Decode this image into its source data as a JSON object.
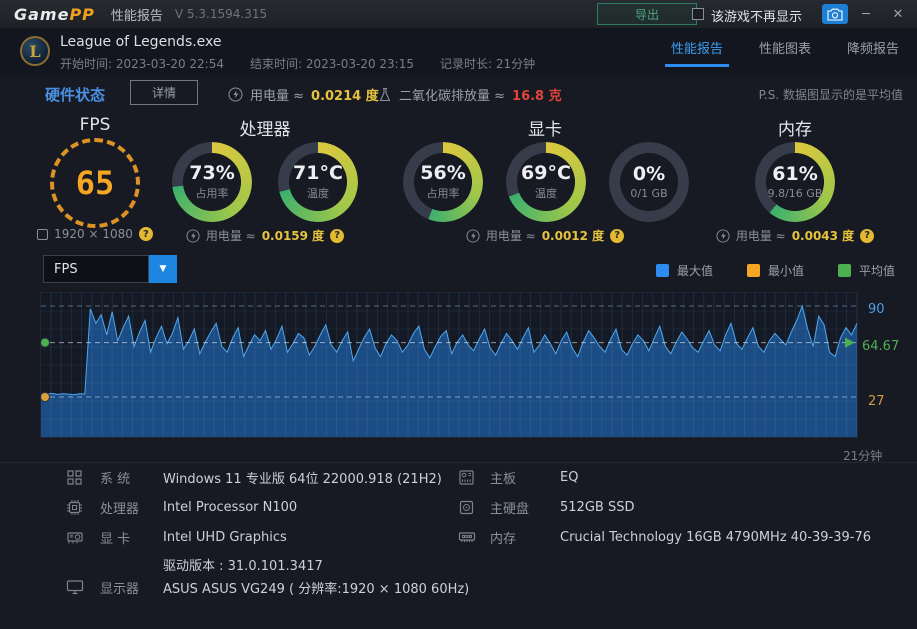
{
  "titlebar": {
    "logo_game": "Game",
    "logo_pp": "PP",
    "app_title": "性能报告",
    "version": "V 5.3.1594.315",
    "export_label": "导出",
    "hide_game_label": "该游戏不再显示",
    "minimize_glyph": "─",
    "close_glyph": "✕"
  },
  "header": {
    "game_icon_letter": "L",
    "game_name": "League of Legends.exe",
    "start_time": "开始时间: 2023-03-20 22:54",
    "end_time": "结束时间: 2023-03-20 23:15",
    "duration": "记录时长: 21分钟",
    "tabs": [
      {
        "label": "性能报告",
        "active": true
      },
      {
        "label": "性能图表",
        "active": false
      },
      {
        "label": "降频报告",
        "active": false
      }
    ]
  },
  "hardware_status": {
    "title": "硬件状态",
    "detail_button": "详情",
    "power_label": "用电量 ≈",
    "power_value": "0.0214 度",
    "co2_label": "二氧化碳排放量 ≈",
    "co2_value": "16.8 克",
    "note": "P.S. 数据图显示的是平均值"
  },
  "sections": {
    "fps": {
      "title": "FPS",
      "value": "65",
      "resolution": "1920 × 1080"
    },
    "cpu": {
      "title": "处理器",
      "gauges": [
        {
          "value": "73%",
          "label": "占用率",
          "pct": 73
        },
        {
          "value": "71°C",
          "label": "温度",
          "pct": 71
        }
      ],
      "power_label": "用电量 ≈",
      "power_value": "0.0159 度"
    },
    "gpu": {
      "title": "显卡",
      "gauges": [
        {
          "value": "56%",
          "label": "占用率",
          "pct": 56
        },
        {
          "value": "69°C",
          "label": "温度",
          "pct": 69
        },
        {
          "value": "0%",
          "label": "0/1 GB",
          "pct": 0
        }
      ],
      "power_label": "用电量 ≈",
      "power_value": "0.0012 度"
    },
    "mem": {
      "title": "内存",
      "gauges": [
        {
          "value": "61%",
          "label": "9.8/16 GB",
          "pct": 61
        }
      ],
      "power_label": "用电量 ≈",
      "power_value": "0.0043 度"
    }
  },
  "chart": {
    "selector_value": "FPS",
    "dropdown_glyph": "▼",
    "legend": [
      {
        "label": "最大值",
        "color": "#2d8cf0"
      },
      {
        "label": "最小值",
        "color": "#f5a623"
      },
      {
        "label": "平均值",
        "color": "#4caf50"
      }
    ],
    "y_max_label": "90",
    "y_avg_label": "64.67",
    "y_min_label": "27",
    "x_label": "21分钟"
  },
  "chart_data": {
    "type": "area",
    "title": "FPS over session",
    "x_label": "21分钟",
    "ylim": [
      0,
      100
    ],
    "markers": {
      "max": 90,
      "avg": 64.67,
      "min": 27
    },
    "legend_position": "top-right",
    "series": [
      {
        "name": "FPS",
        "values": [
          29,
          29,
          29.5,
          28.8,
          29.2,
          29,
          28.6,
          29.3,
          29.1,
          88,
          78,
          84,
          70,
          86,
          66,
          75,
          83,
          62,
          72,
          80,
          58,
          68,
          76,
          64,
          71,
          82,
          60,
          66,
          74,
          57,
          65,
          72,
          78,
          62,
          58,
          68,
          75,
          55,
          63,
          70,
          66,
          73,
          60,
          67,
          76,
          58,
          64,
          71,
          68,
          56,
          62,
          70,
          77,
          63,
          58,
          66,
          72,
          52,
          60,
          68,
          74,
          61,
          55,
          64,
          70,
          66,
          58,
          63,
          71,
          76,
          60,
          54,
          62,
          69,
          73,
          57,
          65,
          70,
          63,
          59,
          67,
          74,
          61,
          56,
          64,
          71,
          66,
          60,
          68,
          75,
          58,
          63,
          70,
          64,
          57,
          66,
          72,
          61,
          55,
          65,
          73,
          68,
          62,
          58,
          67,
          74,
          60,
          56,
          64,
          70,
          66,
          59,
          68,
          76,
          62,
          57,
          65,
          72,
          67,
          61,
          58,
          66,
          73,
          63,
          59,
          70,
          78,
          64,
          60,
          68,
          75,
          62,
          58,
          66,
          71,
          67,
          63,
          72,
          80,
          90,
          74,
          62,
          83,
          77,
          58,
          55,
          68,
          75,
          70,
          78
        ]
      }
    ]
  },
  "sysinfo": {
    "left": [
      {
        "label": "系 统",
        "value": "Windows 11 专业版 64位 22000.918 (21H2)"
      },
      {
        "label": "处理器",
        "value": "Intel Processor N100"
      },
      {
        "label": "显 卡",
        "value": "Intel UHD Graphics"
      },
      {
        "label": "",
        "value": "驱动版本 : 31.0.101.3417"
      },
      {
        "label": "显示器",
        "value": "ASUS ASUS VG249 ( 分辨率:1920 × 1080 60Hz)"
      }
    ],
    "right": [
      {
        "label": "主板",
        "value": "EQ"
      },
      {
        "label": "主硬盘",
        "value": "512GB SSD"
      },
      {
        "label": "内存",
        "value": "Crucial Technology 16GB 4790MHz 40-39-39-76"
      }
    ]
  }
}
